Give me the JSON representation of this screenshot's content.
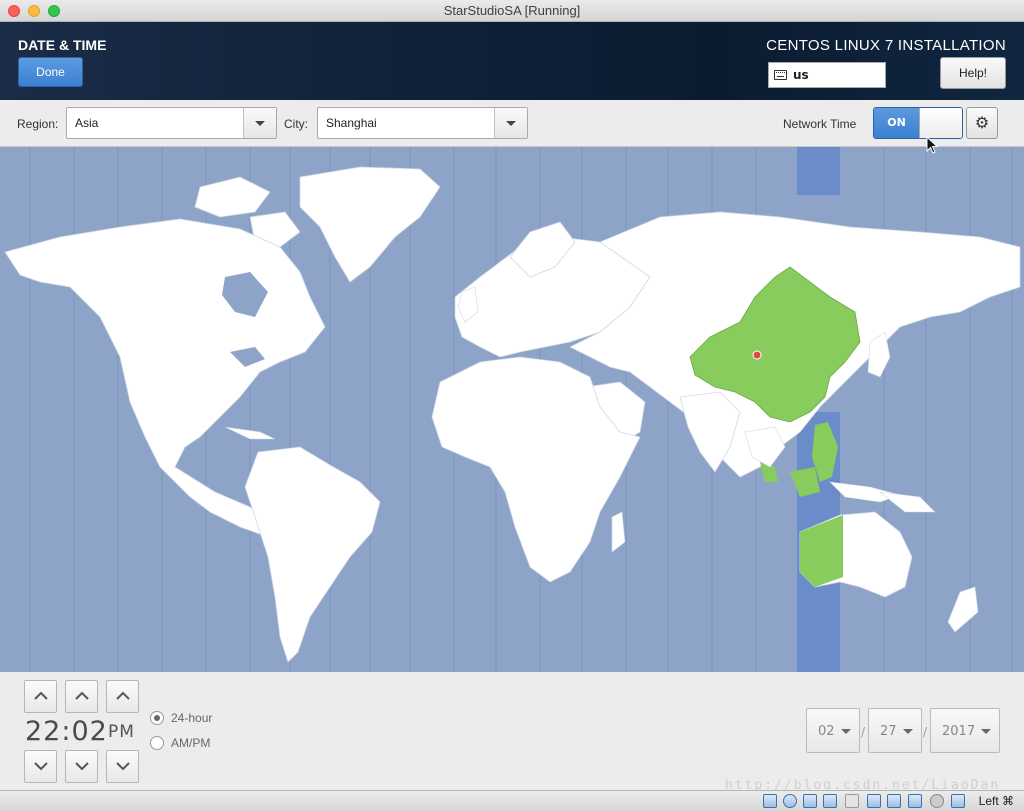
{
  "window": {
    "title": "StarStudioSA [Running]"
  },
  "header": {
    "title": "DATE & TIME",
    "done_label": "Done",
    "install_title": "CENTOS LINUX 7 INSTALLATION",
    "keyboard_layout": "us",
    "help_label": "Help!"
  },
  "toolbar": {
    "region_label": "Region:",
    "region_value": "Asia",
    "city_label": "City:",
    "city_value": "Shanghai",
    "network_time_label": "Network Time",
    "network_time_state": "ON",
    "settings_icon": "gear-icon"
  },
  "map": {
    "selected_city": "Shanghai",
    "ocean_color": "#8da4c8",
    "land_color": "#ffffff",
    "highlight_color": "#87cc5c",
    "timezone_band_color": "#6a8cc8"
  },
  "clock": {
    "hour": "22",
    "minute": "02",
    "time_text": "22:02",
    "period": "PM",
    "format_24h_label": "24-hour",
    "format_ampm_label": "AM/PM",
    "selected_format": "24-hour"
  },
  "date": {
    "month": "02",
    "day": "27",
    "year": "2017",
    "separator": "/"
  },
  "watermark": "http://blog.csdn.net/LiaoDan",
  "statusbar": {
    "host_key": "Left ⌘"
  },
  "colors": {
    "accent": "#3d7fd2",
    "header_bg": "#0f2238"
  }
}
